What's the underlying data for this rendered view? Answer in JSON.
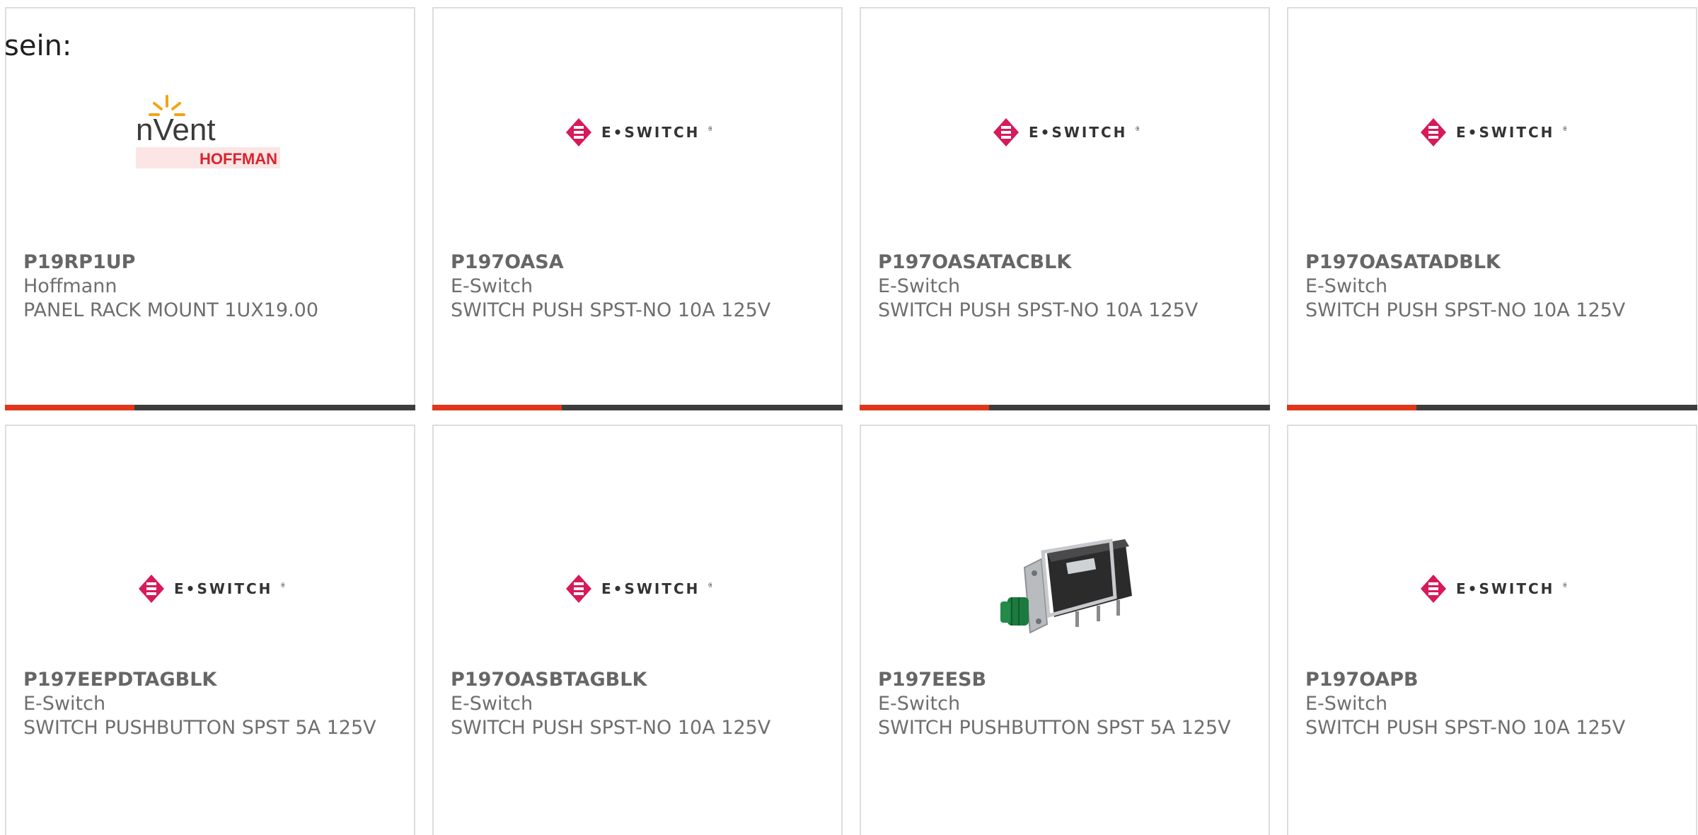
{
  "intro_text": "sein:",
  "brand": {
    "accent_color": "#e0361b",
    "bar_color": "#3d3d3d",
    "eswitch_color": "#d61a5a"
  },
  "logos": {
    "nvent_word": "nVent",
    "hoffman_word": "HOFFMAN",
    "eswitch_word": "E•SWITCH",
    "eswitch_reg": "®"
  },
  "products": [
    {
      "part": "P19RP1UP",
      "manufacturer": "Hoffmann",
      "description": "PANEL RACK MOUNT 1UX19.00",
      "image": "nvent-hoffman-logo"
    },
    {
      "part": "P197OASA",
      "manufacturer": "E-Switch",
      "description": "SWITCH PUSH SPST-NO 10A 125V",
      "image": "eswitch-logo"
    },
    {
      "part": "P197OASATACBLK",
      "manufacturer": "E-Switch",
      "description": "SWITCH PUSH SPST-NO 10A 125V",
      "image": "eswitch-logo"
    },
    {
      "part": "P197OASATADBLK",
      "manufacturer": "E-Switch",
      "description": "SWITCH PUSH SPST-NO 10A 125V",
      "image": "eswitch-logo"
    },
    {
      "part": "P197EEPDTAGBLK",
      "manufacturer": "E-Switch",
      "description": "SWITCH PUSHBUTTON SPST 5A 125V",
      "image": "eswitch-logo"
    },
    {
      "part": "P197OASBTAGBLK",
      "manufacturer": "E-Switch",
      "description": "SWITCH PUSH SPST-NO 10A 125V",
      "image": "eswitch-logo"
    },
    {
      "part": "P197EESB",
      "manufacturer": "E-Switch",
      "description": "SWITCH PUSHBUTTON SPST 5A 125V",
      "image": "pushbutton-switch-photo"
    },
    {
      "part": "P197OAPB",
      "manufacturer": "E-Switch",
      "description": "SWITCH PUSH SPST-NO 10A 125V",
      "image": "eswitch-logo"
    }
  ]
}
